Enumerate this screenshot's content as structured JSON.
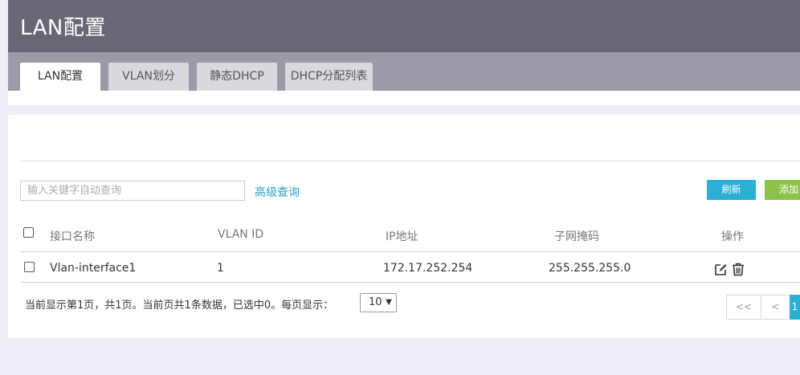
{
  "page": {
    "title": "LAN配置"
  },
  "tabs": [
    {
      "label": "LAN配置",
      "active": true
    },
    {
      "label": "VLAN划分"
    },
    {
      "label": "静态DHCP"
    },
    {
      "label": "DHCP分配列表"
    }
  ],
  "toolbar": {
    "search_placeholder": "输入关键字自动查询",
    "advanced_label": "高级查询",
    "refresh_label": "刷新",
    "add_label": "添加"
  },
  "table": {
    "headers": [
      "接口名称",
      "VLAN ID",
      "IP地址",
      "子网掩码",
      "操作"
    ],
    "rows": [
      {
        "name": "Vlan-interface1",
        "vlan_id": "1",
        "ip": "172.17.252.254",
        "mask": "255.255.255.0"
      }
    ]
  },
  "pagination": {
    "info": "当前显示第1页，共1页。当前页共1条数据，已选中0。每页显示：",
    "page_size": "10",
    "first_label": "<<",
    "prev_label": "<",
    "current_page": "1"
  },
  "colors": {
    "header_bg": "#676874",
    "accent_blue": "#29b0d4",
    "accent_green": "#8cc34a",
    "link": "#2aa0c8"
  },
  "icons": {
    "edit": "edit-icon",
    "delete": "trash-icon"
  }
}
